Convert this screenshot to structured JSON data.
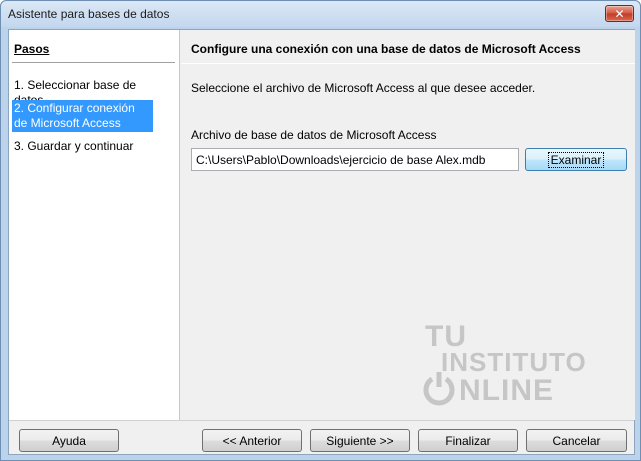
{
  "window": {
    "title": "Asistente para bases de datos",
    "close_label": "✕"
  },
  "steps": {
    "heading": "Pasos",
    "items": [
      {
        "label": "1. Seleccionar base de datos"
      },
      {
        "label": "2. Configurar conexión de Microsoft Access",
        "active": true
      },
      {
        "label": "3. Guardar y continuar"
      }
    ]
  },
  "main": {
    "title": "Configure una conexión con una base de datos de Microsoft Access",
    "instruction": "Seleccione el archivo de Microsoft Access al que desee acceder.",
    "field_label": "Archivo de base de datos de Microsoft Access",
    "file_path": "C:\\Users\\Pablo\\Downloads\\ejercicio de base Alex.mdb",
    "browse_label": "Examinar"
  },
  "watermark": {
    "line1": "TU",
    "line2": "INSTITUTO",
    "line3": "NLINE"
  },
  "footer": {
    "help_label": "Ayuda",
    "back_label": "<< Anterior",
    "next_label": "Siguiente >>",
    "finish_label": "Finalizar",
    "cancel_label": "Cancelar"
  },
  "colors": {
    "selection": "#3399ff",
    "frame": "#bcd3ec",
    "close": "#c03a26"
  }
}
